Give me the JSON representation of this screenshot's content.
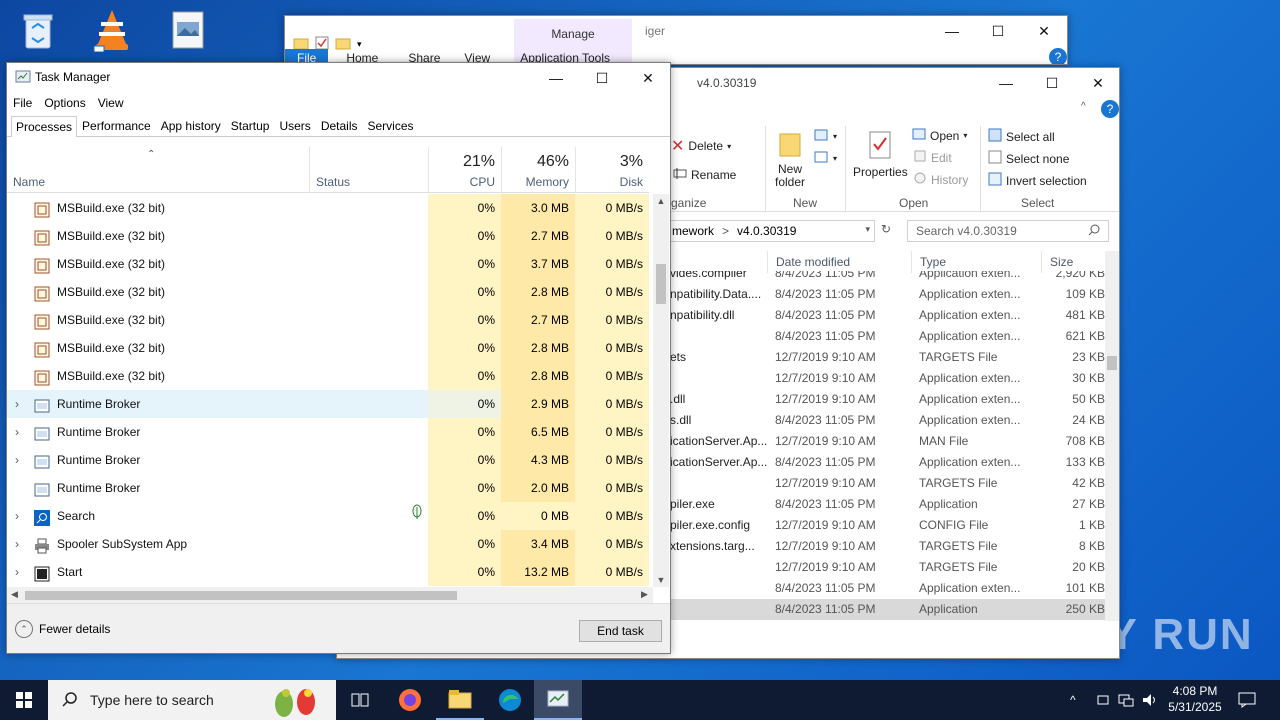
{
  "desktop": {
    "icons": [
      "recycle-bin-icon",
      "vlc-icon",
      "image-file-icon"
    ],
    "watermark": "ANY RUN"
  },
  "explorer_back": {
    "title_partial": "iger",
    "manage_label": "Manage",
    "app_tools_label": "Application Tools",
    "tabs": [
      "File",
      "Home",
      "Share",
      "View"
    ]
  },
  "explorer": {
    "title": "v4.0.30319",
    "ribbon": {
      "delete": "Delete",
      "rename": "Rename",
      "new_folder": "New\nfolder",
      "properties": "Properties",
      "open": "Open",
      "edit": "Edit",
      "history": "History",
      "select_all": "Select all",
      "select_none": "Select none",
      "invert_selection": "Invert selection",
      "groups": {
        "organize": "ganize",
        "new": "New",
        "open": "Open",
        "select": "Select"
      }
    },
    "address": {
      "parent": "mework",
      "separator": ">",
      "current": "v4.0.30319"
    },
    "search_placeholder": "Search v4.0.30319",
    "columns": {
      "date": "Date modified",
      "type": "Type",
      "size": "Size"
    },
    "files": [
      {
        "name": "vides.compiler",
        "date": "8/4/2023 11:05 PM",
        "type": "Application exten...",
        "size": "2,920 KB"
      },
      {
        "name": "npatibility.Data....",
        "date": "8/4/2023 11:05 PM",
        "type": "Application exten...",
        "size": "109 KB"
      },
      {
        "name": "npatibility.dll",
        "date": "8/4/2023 11:05 PM",
        "type": "Application exten...",
        "size": "481 KB"
      },
      {
        "name": "",
        "date": "8/4/2023 11:05 PM",
        "type": "Application exten...",
        "size": "621 KB"
      },
      {
        "name": "ets",
        "date": "12/7/2019 9:10 AM",
        "type": "TARGETS File",
        "size": "23 KB"
      },
      {
        "name": "",
        "date": "12/7/2019 9:10 AM",
        "type": "Application exten...",
        "size": "30 KB"
      },
      {
        "name": ".dll",
        "date": "12/7/2019 9:10 AM",
        "type": "Application exten...",
        "size": "50 KB"
      },
      {
        "name": "s.dll",
        "date": "8/4/2023 11:05 PM",
        "type": "Application exten...",
        "size": "24 KB"
      },
      {
        "name": "icationServer.Ap...",
        "date": "12/7/2019 9:10 AM",
        "type": "MAN File",
        "size": "708 KB"
      },
      {
        "name": "icationServer.Ap...",
        "date": "8/4/2023 11:05 PM",
        "type": "Application exten...",
        "size": "133 KB"
      },
      {
        "name": "",
        "date": "12/7/2019 9:10 AM",
        "type": "TARGETS File",
        "size": "42 KB"
      },
      {
        "name": "piler.exe",
        "date": "8/4/2023 11:05 PM",
        "type": "Application",
        "size": "27 KB"
      },
      {
        "name": "piler.exe.config",
        "date": "12/7/2019 9:10 AM",
        "type": "CONFIG File",
        "size": "1 KB"
      },
      {
        "name": "xtensions.targ...",
        "date": "12/7/2019 9:10 AM",
        "type": "TARGETS File",
        "size": "8 KB"
      },
      {
        "name": "",
        "date": "12/7/2019 9:10 AM",
        "type": "TARGETS File",
        "size": "20 KB"
      },
      {
        "name": "",
        "date": "8/4/2023 11:05 PM",
        "type": "Application exten...",
        "size": "101 KB"
      },
      {
        "name": "",
        "date": "8/4/2023 11:05 PM",
        "type": "Application",
        "size": "250 KB"
      }
    ]
  },
  "taskmanager": {
    "title": "Task Manager",
    "menu": [
      "File",
      "Options",
      "View"
    ],
    "tabs": [
      "Processes",
      "Performance",
      "App history",
      "Startup",
      "Users",
      "Details",
      "Services"
    ],
    "active_tab": "Processes",
    "columns": {
      "name": "Name",
      "status": "Status",
      "cpu": {
        "pct": "21%",
        "label": "CPU"
      },
      "memory": {
        "pct": "46%",
        "label": "Memory"
      },
      "disk": {
        "pct": "3%",
        "label": "Disk"
      }
    },
    "rows": [
      {
        "name": "MSBuild.exe (32 bit)",
        "cpu": "0%",
        "memory": "3.0 MB",
        "disk": "0 MB/s",
        "expandable": false,
        "icon": "msbuild-icon"
      },
      {
        "name": "MSBuild.exe (32 bit)",
        "cpu": "0%",
        "memory": "2.7 MB",
        "disk": "0 MB/s",
        "expandable": false,
        "icon": "msbuild-icon"
      },
      {
        "name": "MSBuild.exe (32 bit)",
        "cpu": "0%",
        "memory": "3.7 MB",
        "disk": "0 MB/s",
        "expandable": false,
        "icon": "msbuild-icon"
      },
      {
        "name": "MSBuild.exe (32 bit)",
        "cpu": "0%",
        "memory": "2.8 MB",
        "disk": "0 MB/s",
        "expandable": false,
        "icon": "msbuild-icon"
      },
      {
        "name": "MSBuild.exe (32 bit)",
        "cpu": "0%",
        "memory": "2.7 MB",
        "disk": "0 MB/s",
        "expandable": false,
        "icon": "msbuild-icon"
      },
      {
        "name": "MSBuild.exe (32 bit)",
        "cpu": "0%",
        "memory": "2.8 MB",
        "disk": "0 MB/s",
        "expandable": false,
        "icon": "msbuild-icon"
      },
      {
        "name": "MSBuild.exe (32 bit)",
        "cpu": "0%",
        "memory": "2.8 MB",
        "disk": "0 MB/s",
        "expandable": false,
        "icon": "msbuild-icon"
      },
      {
        "name": "Runtime Broker",
        "cpu": "0%",
        "memory": "2.9 MB",
        "disk": "0 MB/s",
        "expandable": true,
        "icon": "runtime-broker-icon",
        "highlighted": true
      },
      {
        "name": "Runtime Broker",
        "cpu": "0%",
        "memory": "6.5 MB",
        "disk": "0 MB/s",
        "expandable": true,
        "icon": "runtime-broker-icon"
      },
      {
        "name": "Runtime Broker",
        "cpu": "0%",
        "memory": "4.3 MB",
        "disk": "0 MB/s",
        "expandable": true,
        "icon": "runtime-broker-icon"
      },
      {
        "name": "Runtime Broker",
        "cpu": "0%",
        "memory": "2.0 MB",
        "disk": "0 MB/s",
        "expandable": false,
        "icon": "runtime-broker-icon"
      },
      {
        "name": "Search",
        "cpu": "0%",
        "memory": "0 MB",
        "disk": "0 MB/s",
        "expandable": true,
        "icon": "search-app-icon",
        "suspended": true
      },
      {
        "name": "Spooler SubSystem App",
        "cpu": "0%",
        "memory": "3.4 MB",
        "disk": "0 MB/s",
        "expandable": true,
        "icon": "printer-icon"
      },
      {
        "name": "Start",
        "cpu": "0%",
        "memory": "13.2 MB",
        "disk": "0 MB/s",
        "expandable": true,
        "icon": "start-app-icon"
      }
    ],
    "fewer_details": "Fewer details",
    "end_task": "End task"
  },
  "taskbar": {
    "search_placeholder": "Type here to search",
    "apps": [
      "task-view-icon",
      "firefox-icon",
      "file-explorer-icon",
      "edge-icon",
      "task-manager-icon"
    ],
    "time": "4:08 PM",
    "date": "5/31/2025"
  }
}
